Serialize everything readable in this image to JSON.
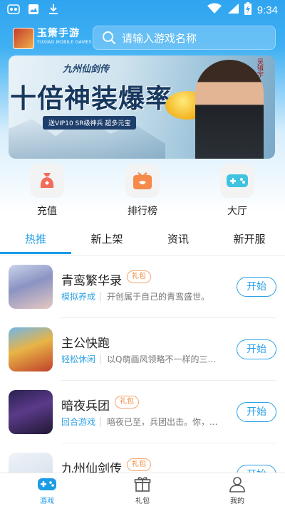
{
  "status_bar": {
    "time": "9:34",
    "left_icons": [
      "app-notification-icon",
      "image-icon",
      "download-icon"
    ],
    "right_icons": [
      "wifi-icon",
      "signal-icon",
      "battery-charging-icon"
    ]
  },
  "header": {
    "logo_title": "玉箫手游",
    "logo_subtitle": "YUXIAO MOBILE GAMES",
    "search_placeholder": "请输入游戏名称"
  },
  "banner": {
    "subtitle": "九州仙剑传",
    "title": "十倍神装爆率",
    "tag": "送VIP10 SR级神兵 超多元宝",
    "signature": "吴镇宇"
  },
  "quick_entries": [
    {
      "label": "充值",
      "icon": "wallet-icon",
      "color": "#f26b5b"
    },
    {
      "label": "排行榜",
      "icon": "ranking-icon",
      "color": "#f58a4b"
    },
    {
      "label": "大厅",
      "icon": "gamepad-icon",
      "color": "#3fc3df"
    }
  ],
  "tabs": [
    {
      "label": "热推",
      "active": true
    },
    {
      "label": "新上架",
      "active": false
    },
    {
      "label": "资讯",
      "active": false
    },
    {
      "label": "新开服",
      "active": false
    }
  ],
  "games": [
    {
      "name": "青鸾繁华录",
      "gift": "礼包",
      "category": "模拟养成",
      "desc": "开创属于自己的青鸾盛世。",
      "action": "开始"
    },
    {
      "name": "主公快跑",
      "gift": "",
      "category": "轻松休闲",
      "desc": "以Q萌画风领略不一样的三...",
      "action": "开始"
    },
    {
      "name": "暗夜兵团",
      "gift": "礼包",
      "category": "回合游戏",
      "desc": "暗夜已至，兵团出击。你，...",
      "action": "开始"
    },
    {
      "name": "九州仙剑传",
      "gift": "礼包",
      "category": "",
      "desc": "",
      "action": "开始"
    }
  ],
  "bottom_nav": [
    {
      "label": "游戏",
      "icon": "gamepad-icon",
      "active": true
    },
    {
      "label": "礼包",
      "icon": "gift-icon",
      "active": false
    },
    {
      "label": "我的",
      "icon": "user-icon",
      "active": false
    }
  ],
  "colors": {
    "accent": "#1c9ce6",
    "gift_tag": "#f08a3c",
    "category": "#31a3e3"
  }
}
